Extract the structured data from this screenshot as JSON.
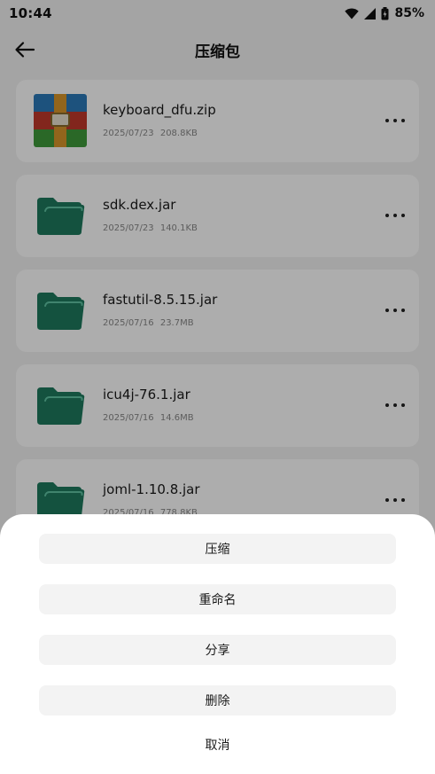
{
  "status_bar": {
    "time": "10:44",
    "battery": "85%",
    "icons": [
      "wifi-icon",
      "cell-signal-icon",
      "battery-icon"
    ]
  },
  "header": {
    "title": "压缩包",
    "back_icon": "arrow-left-icon"
  },
  "files": [
    {
      "name": "keyboard_dfu.zip",
      "date": "2025/07/23",
      "size": "208.8KB",
      "icon": "zip-archive-icon"
    },
    {
      "name": "sdk.dex.jar",
      "date": "2025/07/23",
      "size": "140.1KB",
      "icon": "folder-icon"
    },
    {
      "name": "fastutil-8.5.15.jar",
      "date": "2025/07/16",
      "size": "23.7MB",
      "icon": "folder-icon"
    },
    {
      "name": "icu4j-76.1.jar",
      "date": "2025/07/16",
      "size": "14.6MB",
      "icon": "folder-icon"
    },
    {
      "name": "joml-1.10.8.jar",
      "date": "2025/07/16",
      "size": "778.8KB",
      "icon": "folder-icon"
    }
  ],
  "action_sheet": {
    "compress": "压缩",
    "rename": "重命名",
    "share": "分享",
    "delete": "删除",
    "cancel": "取消"
  },
  "colors": {
    "folder_green": "#1e7a5e",
    "page_background": "#f2f2f2",
    "sheet_button": "#f3f3f3"
  }
}
